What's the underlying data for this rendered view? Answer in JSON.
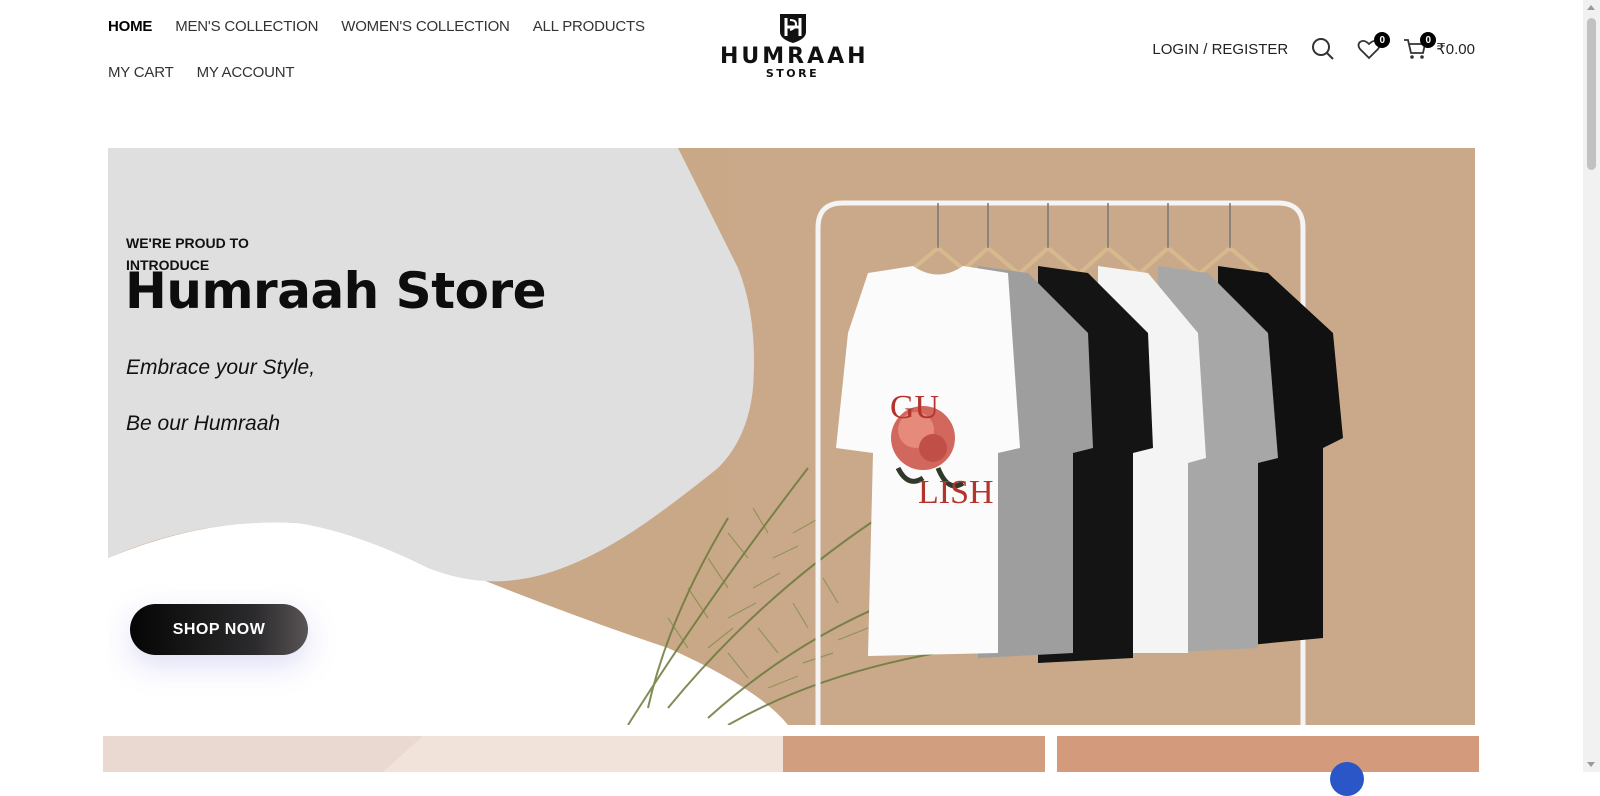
{
  "nav": {
    "items": [
      {
        "label": "HOME"
      },
      {
        "label": "MEN'S COLLECTION"
      },
      {
        "label": "WOMEN'S COLLECTION"
      },
      {
        "label": "ALL PRODUCTS"
      },
      {
        "label": "MY CART"
      },
      {
        "label": "MY ACCOUNT"
      }
    ]
  },
  "logo": {
    "name": "HUMRAAH",
    "sub": "STORE"
  },
  "header": {
    "login_label": "LOGIN / REGISTER",
    "wishlist_count": "0",
    "cart_count": "0",
    "cart_total": "₹0.00",
    "icons": [
      "search-icon",
      "heart-icon",
      "cart-icon"
    ]
  },
  "hero": {
    "intro": "WE'RE PROUD TO INTRODUCE",
    "title": "Humraah Store",
    "tagline_1": "Embrace your Style,",
    "tagline_2": "Be our Humraah",
    "cta_label": "SHOP NOW"
  },
  "colors": {
    "blob": "#e0dfdf",
    "backdrop": "#c6a483",
    "text": "#111111",
    "button": "#050505"
  }
}
